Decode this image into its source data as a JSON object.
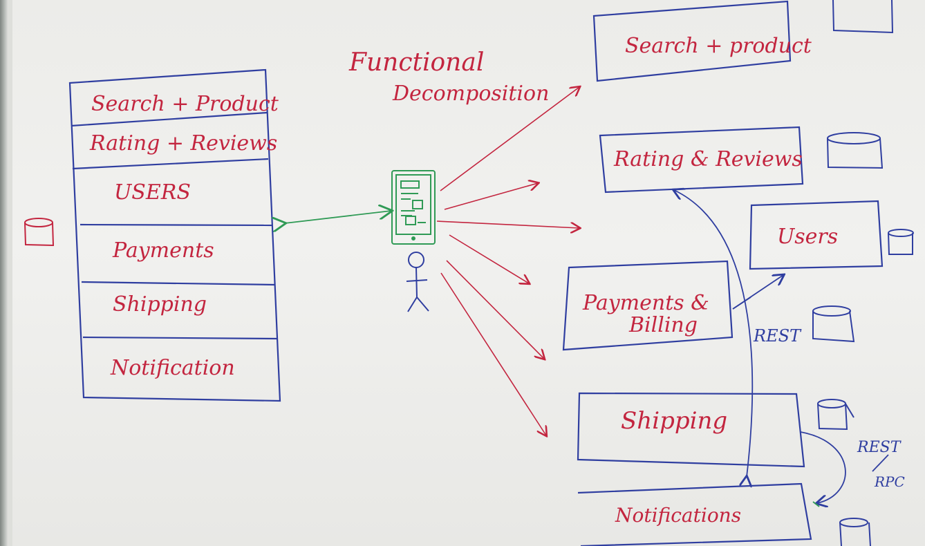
{
  "title": [
    "Functional",
    "Decomposition"
  ],
  "monolith": {
    "modules": [
      "Search + Product",
      "Rating + Reviews",
      "USERS",
      "Payments",
      "Shipping",
      "Notification"
    ]
  },
  "services": {
    "search_product": "Search + product",
    "rating_reviews": "Rating & Reviews",
    "users": "Users",
    "payments": [
      "Payments &",
      "Billing"
    ],
    "shipping": "Shipping",
    "notifications": "Notifications"
  },
  "protocol_labels": {
    "rest_payments": "REST",
    "rest_rpc": [
      "REST",
      "RPC"
    ]
  },
  "colors": {
    "ink_red": "#c3253f",
    "ink_blue": "#2f3ea0",
    "ink_green": "#2f9a55",
    "board": "#efefec"
  }
}
